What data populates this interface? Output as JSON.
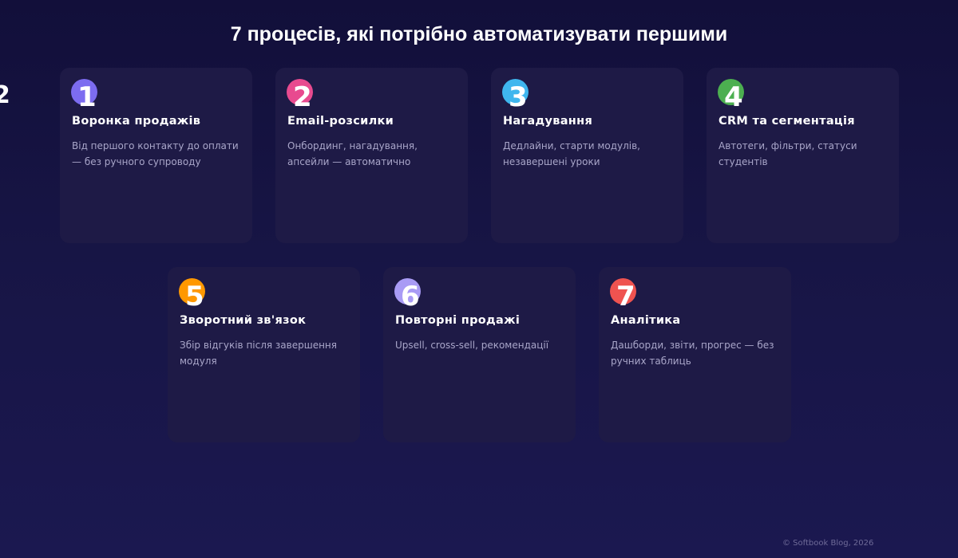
{
  "title": "7 процесів, які потрібно автоматизувати першими",
  "edge_fragment": "2",
  "cards": [
    {
      "number": "1",
      "title": "Воронка продажів",
      "description": "Від першого контакту до оплати — без ручного супроводу",
      "color": "#7c6cf0"
    },
    {
      "number": "2",
      "title": "Email-розсилки",
      "description": "Онбординг, нагадування, апсейли — автоматично",
      "color": "#e84a8f"
    },
    {
      "number": "3",
      "title": "Нагадування",
      "description": "Дедлайни, старти модулів, незавершені уроки",
      "color": "#3fb6ee"
    },
    {
      "number": "4",
      "title": "CRM та сегментація",
      "description": "Автотеги, фільтри, статуси студентів",
      "color": "#4caf50"
    },
    {
      "number": "5",
      "title": "Зворотний зв'язок",
      "description": "Збір відгуків після завершення модуля",
      "color": "#ff9800"
    },
    {
      "number": "6",
      "title": "Повторні продажі",
      "description": "Upsell, cross-sell, рекомендації",
      "color": "#a99bf5"
    },
    {
      "number": "7",
      "title": "Аналітика",
      "description": "Дашборди, звіти, прогрес — без ручних таблиць",
      "color": "#ef5350"
    }
  ],
  "footer": "© Softbook Blog, 2026",
  "colors": {
    "background_top": "#120f3a",
    "background_bottom": "#1b1850",
    "card_background": "#1e1a46",
    "description_text": "#a9a6c9",
    "footer_text": "#6f6b98"
  }
}
